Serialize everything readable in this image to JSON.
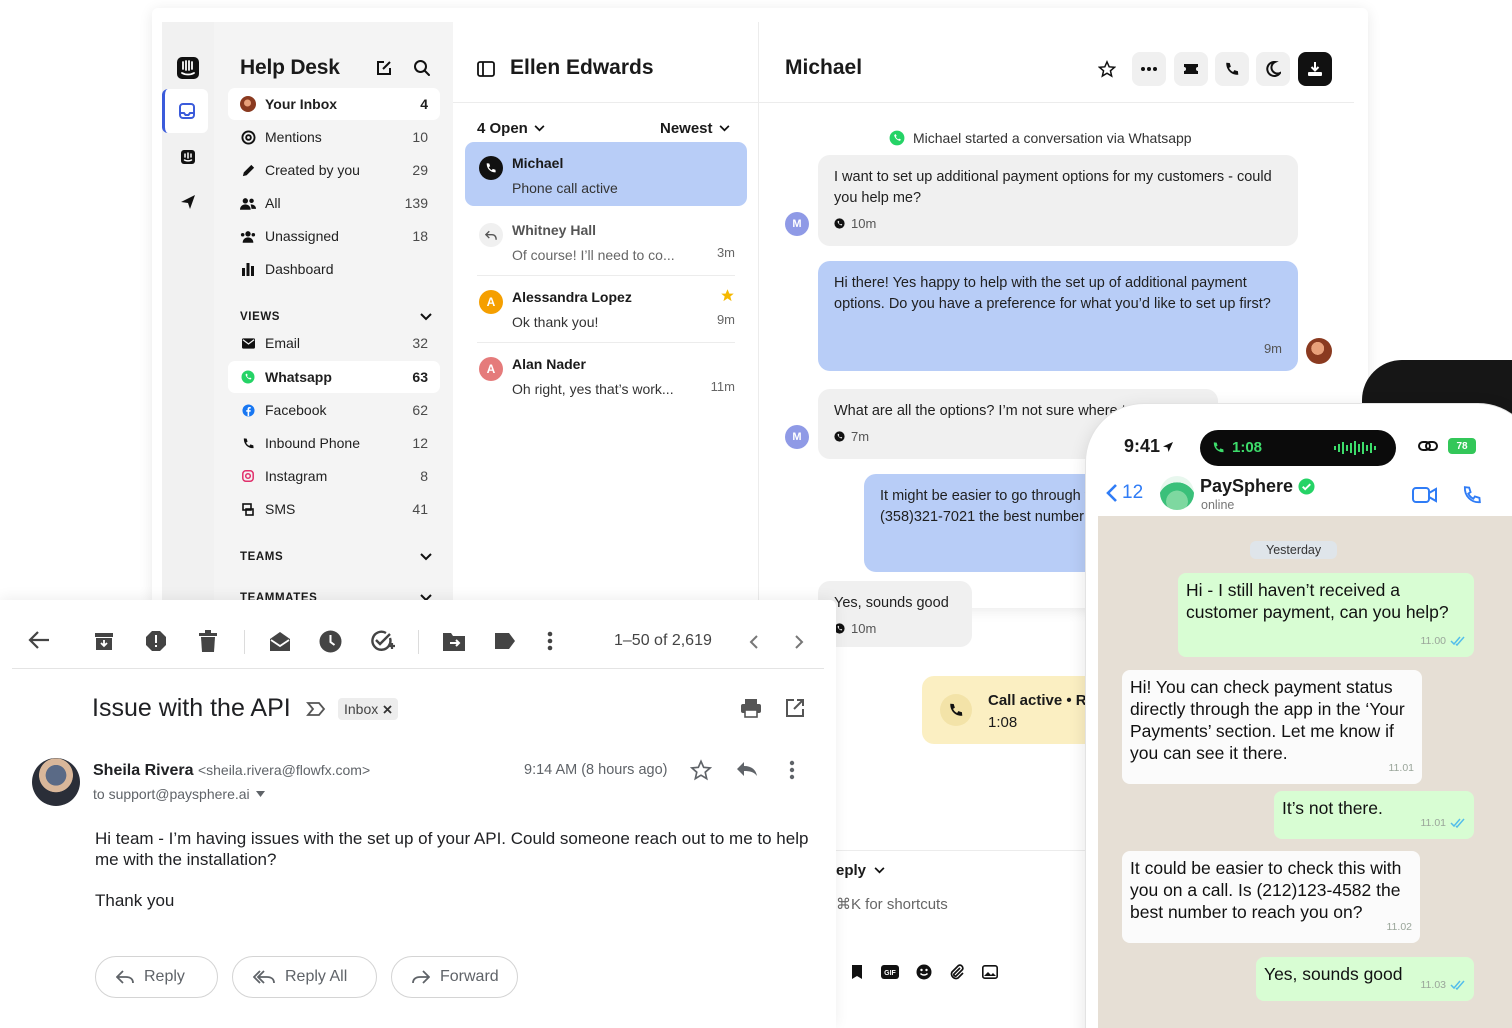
{
  "helpdesk": {
    "sidebar": {
      "title": "Help Desk",
      "items": [
        {
          "label": "Your Inbox",
          "count": "4"
        },
        {
          "label": "Mentions",
          "count": "10"
        },
        {
          "label": "Created by you",
          "count": "29"
        },
        {
          "label": "All",
          "count": "139"
        },
        {
          "label": "Unassigned",
          "count": "18"
        },
        {
          "label": "Dashboard",
          "count": ""
        }
      ],
      "views_heading": "VIEWS",
      "views": [
        {
          "label": "Email",
          "count": "32",
          "icon": "envelope-icon"
        },
        {
          "label": "Whatsapp",
          "count": "63",
          "icon": "whatsapp-icon"
        },
        {
          "label": "Facebook",
          "count": "62",
          "icon": "facebook-icon"
        },
        {
          "label": "Inbound Phone",
          "count": "12",
          "icon": "phone-icon"
        },
        {
          "label": "Instagram",
          "count": "8",
          "icon": "instagram-icon"
        },
        {
          "label": "SMS",
          "count": "41",
          "icon": "sms-icon"
        }
      ],
      "teams_heading": "TEAMS",
      "teammates_heading": "TEAMMATES"
    },
    "list": {
      "title": "Ellen Edwards",
      "filter": "4 Open",
      "sort": "Newest",
      "conversations": [
        {
          "name": "Michael",
          "preview": "Phone call active",
          "time": ""
        },
        {
          "name": "Whitney Hall",
          "preview": "Of course! I’ll need to co...",
          "time": "3m"
        },
        {
          "name": "Alessandra Lopez",
          "preview": "Ok thank you!",
          "time": "9m",
          "avatar": "A"
        },
        {
          "name": "Alan Nader",
          "preview": "Oh right, yes that’s work...",
          "time": "11m",
          "avatar": "A"
        }
      ]
    },
    "chat": {
      "title": "Michael",
      "system_message": "Michael started a conversation via Whatsapp",
      "avatar_letter": "M",
      "messages": [
        {
          "text": "I want to set up additional payment options for my customers - could you help me?",
          "time": "10m"
        },
        {
          "text": "Hi there! Yes happy to help with the set up of additional payment options. Do you have a preference for what you’d like to set up first?",
          "time": "9m"
        },
        {
          "text": "What are all the options? I’m not sure where to start...",
          "time": "7m"
        },
        {
          "text": "It might be easier to go through this on a call. Is (358)321-7021 the best number",
          "time": ""
        },
        {
          "text": "Yes, sounds good",
          "time": "10m"
        }
      ],
      "call_label": "Call active • Re",
      "call_time": "1:08",
      "reply_label": "eply",
      "shortcut_hint": "⌘K for shortcuts"
    }
  },
  "gmail": {
    "pager": "1–50 of 2,619",
    "subject": "Issue with the API",
    "label_chip": "Inbox",
    "sender_name": "Sheila Rivera",
    "sender_email": "<sheila.rivera@flowfx.com>",
    "to": "to support@paysphere.ai",
    "time": "9:14 AM (8 hours ago)",
    "body_1": "Hi team - I’m having issues with the set up of your API. Could someone reach out to me to help me with the installation?",
    "body_2": "Thank you",
    "reply": "Reply",
    "reply_all": "Reply All",
    "forward": "Forward"
  },
  "phone": {
    "clock": "9:41",
    "call_timer": "1:08",
    "battery": "78",
    "back_count": "12",
    "contact": "PaySphere",
    "status": "online",
    "day_label": "Yesterday",
    "messages": [
      {
        "text": "Hi - I still haven’t received a customer payment, can you help?",
        "time": "11.00"
      },
      {
        "text": "Hi! You can check payment status directly through the app in the ‘Your Payments’ section. Let me know if you can see it there.",
        "time": "11.01"
      },
      {
        "text": "It’s not there.",
        "time": "11.01"
      },
      {
        "text": "It could be easier to check this with you on a call. Is (212)123-4582 the best number to reach you on?",
        "time": "11.02"
      },
      {
        "text": "Yes, sounds good",
        "time": "11.03"
      }
    ]
  },
  "colors": {
    "accent": "#3b5bdb",
    "selected": "#b8cdf7",
    "whatsapp": "#25d366",
    "call": "#fbefc2"
  }
}
